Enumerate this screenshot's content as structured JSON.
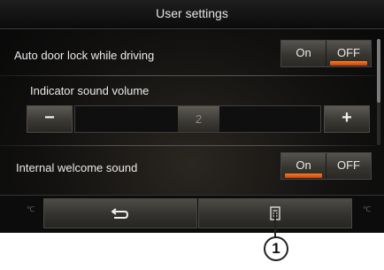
{
  "header": {
    "title": "User settings"
  },
  "settings": {
    "auto_door_lock": {
      "label": "Auto door lock while driving",
      "on_label": "On",
      "off_label": "OFF",
      "selected": "OFF"
    },
    "indicator_volume": {
      "label": "Indicator sound volume",
      "minus_label": "−",
      "plus_label": "+",
      "value": "2"
    },
    "welcome_sound": {
      "label": "Internal welcome sound",
      "on_label": "On",
      "off_label": "OFF",
      "selected": "On"
    }
  },
  "bottom_bar": {
    "back_icon": "back-arrow-icon",
    "back_glyph": "⮌",
    "menu_icon": "list-menu-icon"
  },
  "annotation": {
    "callout_number": "1"
  },
  "colors": {
    "active_indicator": "#ff6a1a",
    "background": "#0b0b0b",
    "text": "#eaeaea"
  }
}
